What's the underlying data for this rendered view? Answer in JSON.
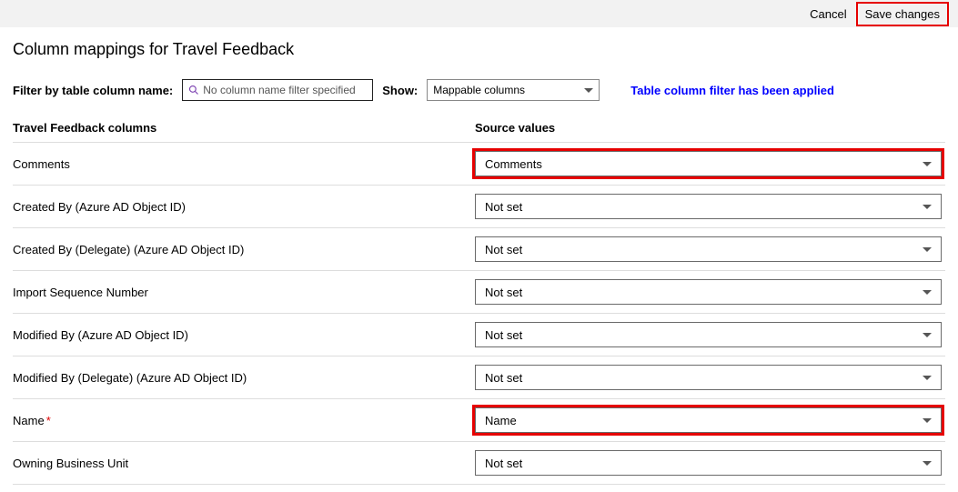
{
  "topbar": {
    "cancel": "Cancel",
    "save": "Save changes"
  },
  "title": "Column mappings for Travel Feedback",
  "filter": {
    "label": "Filter by table column name:",
    "placeholder": "No column name filter specified",
    "show_label": "Show:",
    "show_value": "Mappable columns",
    "applied_msg": "Table column filter has been applied"
  },
  "headers": {
    "left": "Travel Feedback columns",
    "right": "Source values"
  },
  "rows": [
    {
      "label": "Comments",
      "value": "Comments",
      "required": false,
      "highlight": true
    },
    {
      "label": "Created By (Azure AD Object ID)",
      "value": "Not set",
      "required": false,
      "highlight": false
    },
    {
      "label": "Created By (Delegate) (Azure AD Object ID)",
      "value": "Not set",
      "required": false,
      "highlight": false
    },
    {
      "label": "Import Sequence Number",
      "value": "Not set",
      "required": false,
      "highlight": false
    },
    {
      "label": "Modified By (Azure AD Object ID)",
      "value": "Not set",
      "required": false,
      "highlight": false
    },
    {
      "label": "Modified By (Delegate) (Azure AD Object ID)",
      "value": "Not set",
      "required": false,
      "highlight": false
    },
    {
      "label": "Name",
      "value": "Name",
      "required": true,
      "highlight": true
    },
    {
      "label": "Owning Business Unit",
      "value": "Not set",
      "required": false,
      "highlight": false
    }
  ]
}
